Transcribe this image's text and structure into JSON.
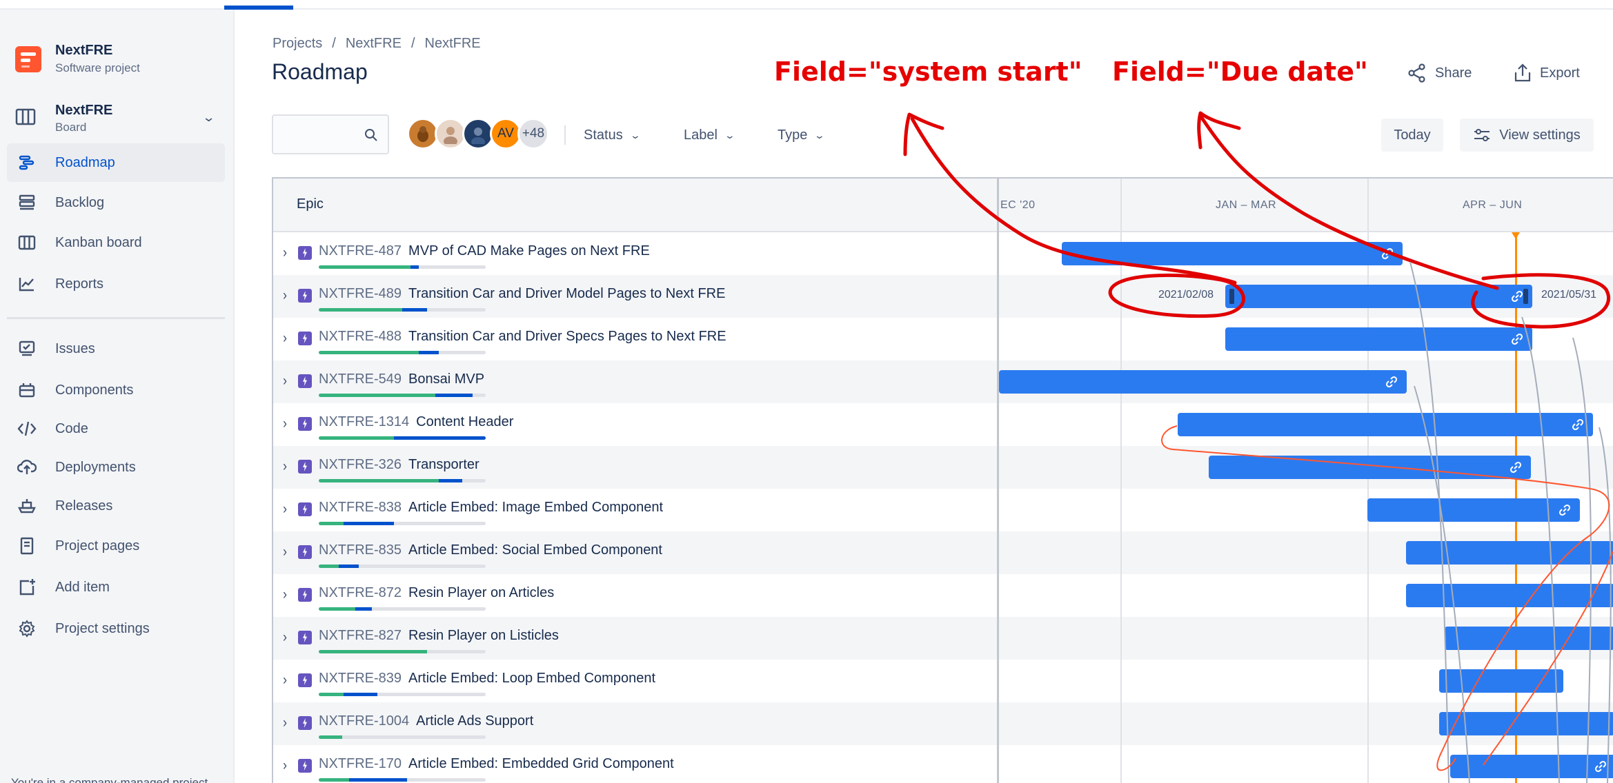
{
  "project": {
    "name": "NextFRE",
    "type": "Software project"
  },
  "board": {
    "name": "NextFRE",
    "sub": "Board"
  },
  "nav": [
    {
      "label": "Roadmap",
      "icon": "roadmap-icon"
    },
    {
      "label": "Backlog",
      "icon": "backlog-icon"
    },
    {
      "label": "Kanban board",
      "icon": "kanban-icon"
    },
    {
      "label": "Reports",
      "icon": "reports-icon"
    },
    {
      "label": "Issues",
      "icon": "issues-icon"
    },
    {
      "label": "Components",
      "icon": "components-icon"
    },
    {
      "label": "Code",
      "icon": "code-icon"
    },
    {
      "label": "Deployments",
      "icon": "deployments-icon"
    },
    {
      "label": "Releases",
      "icon": "releases-icon"
    },
    {
      "label": "Project pages",
      "icon": "pages-icon"
    },
    {
      "label": "Add item",
      "icon": "add-item-icon"
    },
    {
      "label": "Project settings",
      "icon": "settings-icon"
    }
  ],
  "sidebar_footer": "You're in a company-managed project",
  "breadcrumb": [
    "Projects",
    "NextFRE",
    "NextFRE"
  ],
  "page_title": "Roadmap",
  "actions": {
    "share": "Share",
    "export": "Export"
  },
  "annotations": {
    "start": "Field=\"system start\"",
    "due": "Field=\"Due date\""
  },
  "toolbar": {
    "avatar_initials": "AV",
    "avatar_more": "+48",
    "filters": [
      "Status",
      "Label",
      "Type"
    ],
    "today": "Today",
    "view_settings": "View settings"
  },
  "timeline": {
    "epic_header": "Epic",
    "columns": [
      "EC '20",
      "JAN – MAR",
      "APR – JUN"
    ],
    "start_date_label": "2021/02/08",
    "due_date_label": "2021/05/31"
  },
  "colors": {
    "bar": "#2b7bf0",
    "today": "#ff8b00",
    "epic": "#6554c0",
    "annotation": "#e60000"
  },
  "epics": [
    {
      "key": "NXTFRE-487",
      "summary": "MVP of CAD Make Pages on Next FRE",
      "done": 0.55,
      "inprogress": 0.05
    },
    {
      "key": "NXTFRE-489",
      "summary": "Transition Car and Driver Model Pages to Next FRE",
      "done": 0.5,
      "inprogress": 0.15
    },
    {
      "key": "NXTFRE-488",
      "summary": "Transition Car and Driver Specs Pages to Next FRE",
      "done": 0.6,
      "inprogress": 0.12
    },
    {
      "key": "NXTFRE-549",
      "summary": "Bonsai MVP",
      "done": 0.7,
      "inprogress": 0.22
    },
    {
      "key": "NXTFRE-1314",
      "summary": "Content Header",
      "done": 0.45,
      "inprogress": 0.55
    },
    {
      "key": "NXTFRE-326",
      "summary": "Transporter",
      "done": 0.72,
      "inprogress": 0.14
    },
    {
      "key": "NXTFRE-838",
      "summary": "Article Embed: Image Embed Component",
      "done": 0.15,
      "inprogress": 0.3
    },
    {
      "key": "NXTFRE-835",
      "summary": "Article Embed: Social Embed Component",
      "done": 0.12,
      "inprogress": 0.12
    },
    {
      "key": "NXTFRE-872",
      "summary": "Resin Player on Articles",
      "done": 0.22,
      "inprogress": 0.1
    },
    {
      "key": "NXTFRE-827",
      "summary": "Resin Player on Listicles",
      "done": 0.65,
      "inprogress": 0.0
    },
    {
      "key": "NXTFRE-839",
      "summary": "Article Embed: Loop Embed Component",
      "done": 0.15,
      "inprogress": 0.2
    },
    {
      "key": "NXTFRE-1004",
      "summary": "Article Ads Support",
      "done": 0.14,
      "inprogress": 0.0
    },
    {
      "key": "NXTFRE-170",
      "summary": "Article Embed: Embedded Grid Component",
      "done": 0.18,
      "inprogress": 0.35
    }
  ]
}
